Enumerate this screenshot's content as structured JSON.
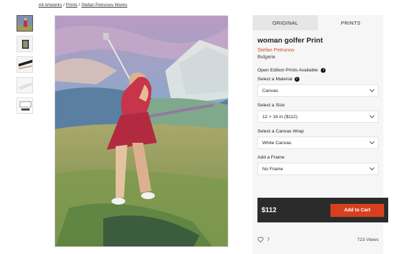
{
  "breadcrumb": {
    "items": [
      "All Artworks",
      "Prints",
      "Stefan Petrunov Works"
    ],
    "separator": "/"
  },
  "thumbnails": [
    "painting",
    "framed-on-wall",
    "side-view",
    "angled-view",
    "room-view"
  ],
  "tabs": {
    "original": "ORIGINAL",
    "prints": "PRINTS"
  },
  "artwork": {
    "title": "woman golfer Print",
    "artist": "Stefan Petrunov",
    "country": "Bulgaria"
  },
  "options": {
    "availability_label": "Open Edition Prints Available:",
    "material_label": "Select a Material",
    "material_value": "Canvas",
    "size_label": "Select a Size",
    "size_value": "12 × 16 in ($112)",
    "wrap_label": "Select a Canvas Wrap",
    "wrap_value": "White Canvas",
    "frame_label": "Add a Frame",
    "frame_value": "No Frame"
  },
  "purchase": {
    "price": "$112",
    "cart_label": "Add to Cart"
  },
  "stats": {
    "likes": "7",
    "views": "723 Views"
  },
  "colors": {
    "accent": "#d6401e",
    "artist_link": "#d14b2a",
    "price_bar": "#2b2b2b"
  }
}
